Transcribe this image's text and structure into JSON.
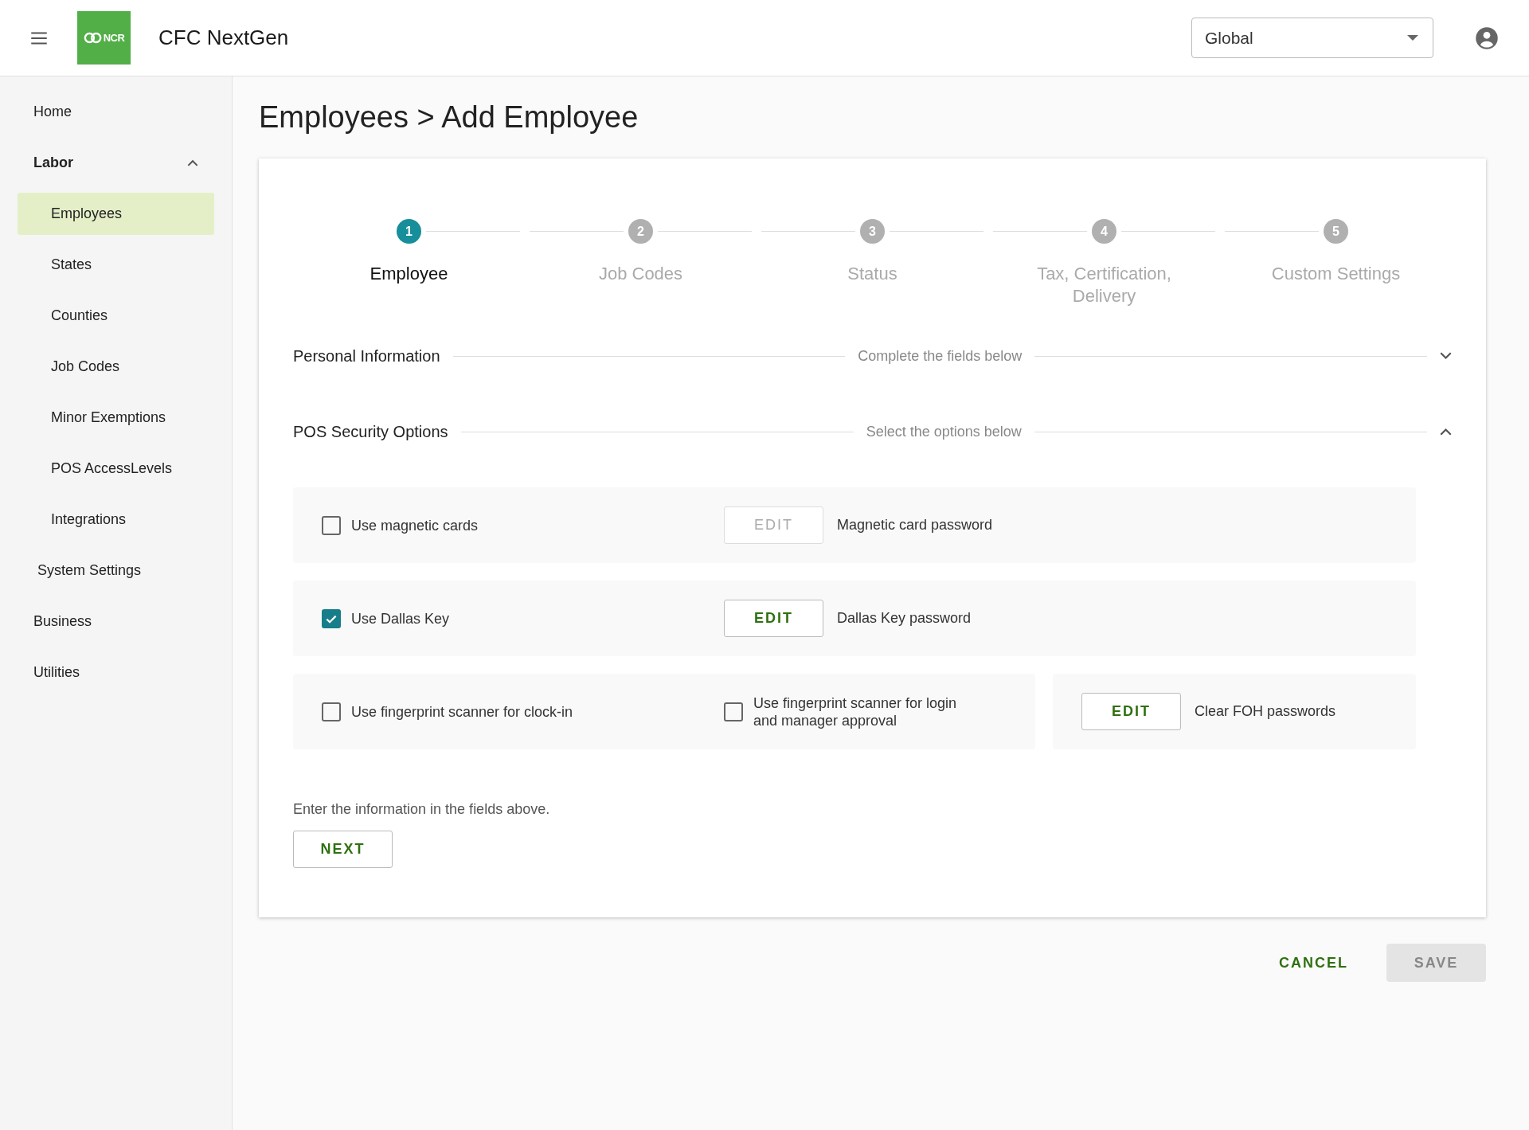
{
  "header": {
    "logo_text": "NCR",
    "app_title": "CFC NextGen",
    "scope_select": {
      "value": "Global"
    }
  },
  "sidebar": {
    "items": [
      {
        "label": "Home",
        "selected": false
      },
      {
        "label": "Labor",
        "selected": false,
        "expanded": true,
        "children": [
          {
            "label": "Employees",
            "selected": true
          },
          {
            "label": "States",
            "selected": false
          },
          {
            "label": "Counties",
            "selected": false
          },
          {
            "label": "Job Codes",
            "selected": false
          },
          {
            "label": "Minor Exemptions",
            "selected": false
          },
          {
            "label": "POS AccessLevels",
            "selected": false
          },
          {
            "label": "Integrations",
            "selected": false
          }
        ]
      },
      {
        "label": "System Settings",
        "selected": false,
        "indented": true
      },
      {
        "label": "Business",
        "selected": false
      },
      {
        "label": "Utilities",
        "selected": false
      }
    ]
  },
  "page_title": "Employees > Add Employee",
  "stepper": {
    "steps": [
      {
        "number": "1",
        "label": "Employee",
        "selected": true
      },
      {
        "number": "2",
        "label": "Job Codes",
        "selected": false
      },
      {
        "number": "3",
        "label": "Status",
        "selected": false
      },
      {
        "number": "4",
        "label": "Tax, Certification, Delivery",
        "selected": false
      },
      {
        "number": "5",
        "label": "Custom Settings",
        "selected": false
      }
    ]
  },
  "sections": [
    {
      "title": "Personal Information",
      "hint": "Complete the fields below",
      "expanded": false
    },
    {
      "title": "POS Security Options",
      "hint": "Select the options below",
      "expanded": true
    }
  ],
  "option_rows": [
    {
      "panels": [
        {
          "items": [
            {
              "kind": "checkbox",
              "label": "Use magnetic cards",
              "checked": false
            },
            {
              "kind": "edit",
              "button": "EDIT",
              "label": "Magnetic card password",
              "disabled": true
            }
          ]
        }
      ]
    },
    {
      "panels": [
        {
          "items": [
            {
              "kind": "checkbox",
              "label": "Use Dallas Key",
              "checked": true
            },
            {
              "kind": "edit",
              "button": "EDIT",
              "label": "Dallas Key password",
              "disabled": false
            }
          ]
        }
      ]
    },
    {
      "panels": [
        {
          "items": [
            {
              "kind": "checkbox",
              "label": "Use fingerprint scanner for clock-in",
              "checked": false
            },
            {
              "kind": "checkbox",
              "label": "Use fingerprint scanner for login and manager approval",
              "checked": false
            }
          ]
        },
        {
          "items": [
            {
              "kind": "edit",
              "button": "EDIT",
              "label": "Clear FOH passwords",
              "disabled": false
            }
          ]
        }
      ]
    }
  ],
  "form_hint": "Enter the information in the fields above.",
  "next_button": "NEXT",
  "actions": {
    "cancel": "CANCEL",
    "save": {
      "label": "SAVE",
      "disabled": true
    }
  }
}
